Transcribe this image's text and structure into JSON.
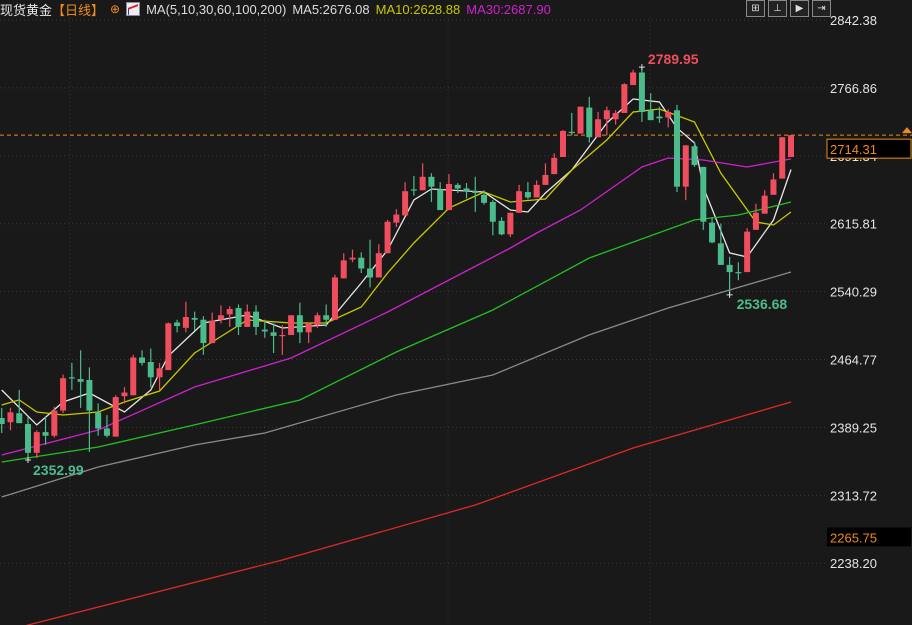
{
  "header": {
    "instrument": "现货黄金",
    "period": "【日线】",
    "ma_settings": "MA(5,10,30,60,100,200)",
    "ma5_label": "MA5:2676.08",
    "ma10_label": "MA10:2628.88",
    "ma30_label": "MA30:2687.90",
    "tools": [
      {
        "icon": "crosshair-icon",
        "glyph": "⊞"
      },
      {
        "icon": "zoom-in-icon",
        "glyph": "⊥"
      },
      {
        "icon": "play-icon",
        "glyph": "▶"
      },
      {
        "icon": "export-icon",
        "glyph": "⇥"
      }
    ]
  },
  "colors": {
    "background": "#191919",
    "up": "#f04e5e",
    "down": "#4cbb8c",
    "ma5": "#e6e6e6",
    "ma10": "#c8c800",
    "ma30": "#d020d0",
    "ma60": "#22c022",
    "ma100": "#8a8a8a",
    "ma200": "#e02828",
    "last_price": "#f08a1c"
  },
  "chart_data": {
    "type": "candlestick",
    "title": "",
    "ylim": [
      2210,
      2860
    ],
    "y_ticks": [
      "2842.38",
      "2766.86",
      "2691.34",
      "2615.81",
      "2540.29",
      "2464.77",
      "2389.25",
      "2313.72",
      "2238.20"
    ],
    "y_tick_values": [
      2842.38,
      2766.86,
      2691.34,
      2615.81,
      2540.29,
      2464.77,
      2389.25,
      2313.72,
      2238.2
    ],
    "grid": true,
    "last_price": {
      "value": 2714.31,
      "label": "2714.31"
    },
    "low_marker": {
      "value": 2265.75,
      "label": "2265.75"
    },
    "max_annotation": {
      "candle": 74,
      "value": 2789.95,
      "label": "2789.95"
    },
    "min_annotation": {
      "candle": 84,
      "value": 2536.68,
      "label": "2536.68"
    },
    "left_min_annotation": {
      "candle": 4,
      "value": 2352.99,
      "label": "2352.99"
    },
    "candles_ohlc": [
      [
        2399.7,
        2411,
        2383,
        2393
      ],
      [
        2395,
        2411,
        2386,
        2406
      ],
      [
        2405,
        2431,
        2394,
        2394
      ],
      [
        2393,
        2401,
        2352.99,
        2361
      ],
      [
        2361,
        2386,
        2355,
        2384
      ],
      [
        2384,
        2401,
        2370,
        2380
      ],
      [
        2380,
        2412,
        2378,
        2408
      ],
      [
        2408,
        2448,
        2405,
        2444
      ],
      [
        2445,
        2461,
        2431,
        2444
      ],
      [
        2443,
        2475,
        2411,
        2440
      ],
      [
        2442,
        2456,
        2362,
        2408
      ],
      [
        2406,
        2416,
        2380,
        2388
      ],
      [
        2388,
        2403,
        2378,
        2380
      ],
      [
        2379,
        2425,
        2379,
        2423
      ],
      [
        2424,
        2434,
        2416,
        2428
      ],
      [
        2425,
        2470,
        2425,
        2467
      ],
      [
        2467,
        2475,
        2458,
        2461
      ],
      [
        2462,
        2477,
        2434,
        2445
      ],
      [
        2445,
        2461,
        2431,
        2455
      ],
      [
        2453,
        2506,
        2453,
        2505
      ],
      [
        2506,
        2509,
        2495,
        2502
      ],
      [
        2500,
        2529,
        2495,
        2512
      ],
      [
        2511,
        2518,
        2497,
        2509
      ],
      [
        2509,
        2513,
        2470,
        2483
      ],
      [
        2483,
        2517,
        2483,
        2508
      ],
      [
        2509,
        2525,
        2505,
        2514
      ],
      [
        2515,
        2524,
        2501,
        2521
      ],
      [
        2522,
        2526,
        2492,
        2501
      ],
      [
        2501,
        2526,
        2501,
        2518
      ],
      [
        2518,
        2525,
        2492,
        2501
      ],
      [
        2498,
        2509,
        2489,
        2496
      ],
      [
        2495,
        2505,
        2472,
        2491
      ],
      [
        2491,
        2503,
        2470,
        2492
      ],
      [
        2492,
        2514,
        2492,
        2514
      ],
      [
        2514,
        2528,
        2483,
        2495
      ],
      [
        2495,
        2506,
        2483,
        2505
      ],
      [
        2503,
        2517,
        2500,
        2514
      ],
      [
        2514,
        2526,
        2501,
        2509
      ],
      [
        2509,
        2559,
        2509,
        2556
      ],
      [
        2555,
        2583,
        2555,
        2575
      ],
      [
        2576,
        2587,
        2573,
        2578
      ],
      [
        2578,
        2584,
        2561,
        2566
      ],
      [
        2566,
        2598,
        2545,
        2556
      ],
      [
        2556,
        2593,
        2556,
        2583
      ],
      [
        2583,
        2620,
        2583,
        2618
      ],
      [
        2617,
        2632,
        2612,
        2626
      ],
      [
        2625,
        2662,
        2625,
        2652
      ],
      [
        2654,
        2669,
        2647,
        2653
      ],
      [
        2653,
        2683,
        2653,
        2668
      ],
      [
        2668,
        2672,
        2640,
        2657
      ],
      [
        2654,
        2662,
        2631,
        2631
      ],
      [
        2631,
        2671,
        2631,
        2660
      ],
      [
        2659,
        2661,
        2650,
        2655
      ],
      [
        2655,
        2661,
        2644,
        2652
      ],
      [
        2652,
        2668,
        2629,
        2650
      ],
      [
        2648,
        2653,
        2637,
        2639
      ],
      [
        2640,
        2642,
        2603,
        2618
      ],
      [
        2619,
        2623,
        2603,
        2604
      ],
      [
        2604,
        2628,
        2601,
        2628
      ],
      [
        2628,
        2659,
        2628,
        2652
      ],
      [
        2651,
        2662,
        2643,
        2645
      ],
      [
        2645,
        2664,
        2645,
        2659
      ],
      [
        2659,
        2683,
        2659,
        2670
      ],
      [
        2671,
        2694,
        2671,
        2689
      ],
      [
        2690,
        2720,
        2690,
        2719
      ],
      [
        2718,
        2739,
        2714,
        2717
      ],
      [
        2716,
        2746,
        2716,
        2746
      ],
      [
        2745,
        2757,
        2706,
        2712
      ],
      [
        2712,
        2740,
        2712,
        2732
      ],
      [
        2732,
        2746,
        2714,
        2742
      ],
      [
        2732,
        2742,
        2726,
        2739
      ],
      [
        2739,
        2772,
        2739,
        2771
      ],
      [
        2770,
        2787,
        2770,
        2784
      ],
      [
        2784,
        2789.95,
        2729,
        2740
      ],
      [
        2742,
        2761,
        2731,
        2731
      ],
      [
        2735,
        2746,
        2728,
        2733
      ],
      [
        2734,
        2743,
        2723,
        2740
      ],
      [
        2742,
        2748,
        2651,
        2657
      ],
      [
        2657,
        2703,
        2642,
        2703
      ],
      [
        2702,
        2707,
        2679,
        2681
      ],
      [
        2679,
        2679,
        2609,
        2618
      ],
      [
        2617,
        2623,
        2594,
        2595
      ],
      [
        2594,
        2616,
        2570,
        2570
      ],
      [
        2570,
        2579,
        2536.68,
        2562
      ],
      [
        2562,
        2573,
        2553,
        2561
      ],
      [
        2562,
        2611,
        2562,
        2607
      ],
      [
        2609,
        2638,
        2609,
        2628
      ],
      [
        2627,
        2653,
        2627,
        2647
      ],
      [
        2648,
        2672,
        2648,
        2665
      ],
      [
        2666,
        2712,
        2666,
        2712
      ],
      [
        2690,
        2714.31,
        2690,
        2714.31
      ]
    ],
    "moving_averages": [
      {
        "name": "MA5",
        "color_key": "ma5",
        "points": [
          [
            1,
            2430.9
          ],
          [
            5,
            2392
          ],
          [
            8,
            2417.5
          ],
          [
            11,
            2427.5
          ],
          [
            15,
            2406.4
          ],
          [
            18,
            2430.9
          ],
          [
            20,
            2468.7
          ],
          [
            24,
            2505.4
          ],
          [
            29,
            2514.3
          ],
          [
            33,
            2499.8
          ],
          [
            38,
            2503.2
          ],
          [
            42,
            2549.9
          ],
          [
            45,
            2586.6
          ],
          [
            48,
            2642.2
          ],
          [
            50,
            2654.4
          ],
          [
            56,
            2651.1
          ],
          [
            59,
            2631.1
          ],
          [
            61,
            2628.8
          ],
          [
            63,
            2650
          ],
          [
            66,
            2675.6
          ],
          [
            70,
            2727.8
          ],
          [
            73,
            2754.5
          ],
          [
            76,
            2751.2
          ],
          [
            78,
            2722.3
          ],
          [
            80,
            2705.6
          ],
          [
            81,
            2656.6
          ],
          [
            84,
            2583.3
          ],
          [
            86,
            2578.8
          ],
          [
            89,
            2620
          ],
          [
            91,
            2676.08
          ]
        ]
      },
      {
        "name": "MA10",
        "color_key": "ma10",
        "points": [
          [
            1,
            2414.2
          ],
          [
            3,
            2419.8
          ],
          [
            5,
            2406.4
          ],
          [
            8,
            2403.1
          ],
          [
            12,
            2406.4
          ],
          [
            15,
            2417.5
          ],
          [
            19,
            2429.8
          ],
          [
            23,
            2472
          ],
          [
            29,
            2508.7
          ],
          [
            34,
            2505.4
          ],
          [
            38,
            2505.4
          ],
          [
            42,
            2523.2
          ],
          [
            45,
            2561
          ],
          [
            48,
            2594.4
          ],
          [
            52,
            2633.3
          ],
          [
            56,
            2651.1
          ],
          [
            59,
            2640
          ],
          [
            63,
            2643.3
          ],
          [
            66,
            2675.6
          ],
          [
            70,
            2708.9
          ],
          [
            73,
            2740.1
          ],
          [
            76,
            2743.4
          ],
          [
            80,
            2728.9
          ],
          [
            83,
            2672.2
          ],
          [
            87,
            2617.7
          ],
          [
            89,
            2614.4
          ],
          [
            91,
            2628.88
          ]
        ]
      },
      {
        "name": "MA30",
        "color_key": "ma30",
        "points": [
          [
            1,
            2358.6
          ],
          [
            12,
            2386.4
          ],
          [
            23,
            2434.2
          ],
          [
            34,
            2466.5
          ],
          [
            45,
            2517.6
          ],
          [
            59,
            2588.8
          ],
          [
            62,
            2605.5
          ],
          [
            67,
            2631.1
          ],
          [
            74,
            2678.9
          ],
          [
            77,
            2688.9
          ],
          [
            81,
            2686.7
          ],
          [
            86,
            2678.9
          ],
          [
            91,
            2687.9
          ]
        ]
      },
      {
        "name": "MA60",
        "color_key": "ma60",
        "points": [
          [
            1,
            2350.8
          ],
          [
            12,
            2367.5
          ],
          [
            23,
            2392
          ],
          [
            35,
            2419.7
          ],
          [
            46,
            2473.1
          ],
          [
            57,
            2519.8
          ],
          [
            68,
            2577.7
          ],
          [
            80,
            2620
          ],
          [
            85,
            2625.5
          ],
          [
            91,
            2640
          ]
        ]
      },
      {
        "name": "MA100",
        "color_key": "ma100",
        "points": [
          [
            1,
            2311.9
          ],
          [
            12,
            2345.2
          ],
          [
            23,
            2369.7
          ],
          [
            31,
            2383
          ],
          [
            46,
            2425.3
          ],
          [
            57,
            2447.5
          ],
          [
            68,
            2492.1
          ],
          [
            77,
            2522.1
          ],
          [
            91,
            2562.1
          ]
        ]
      },
      {
        "name": "MA200",
        "color_key": "ma200",
        "points": [
          [
            1,
            2160
          ],
          [
            4,
            2169.5
          ],
          [
            33,
            2241.8
          ],
          [
            55,
            2303
          ],
          [
            73,
            2366.4
          ],
          [
            91,
            2417.5
          ]
        ]
      }
    ]
  }
}
